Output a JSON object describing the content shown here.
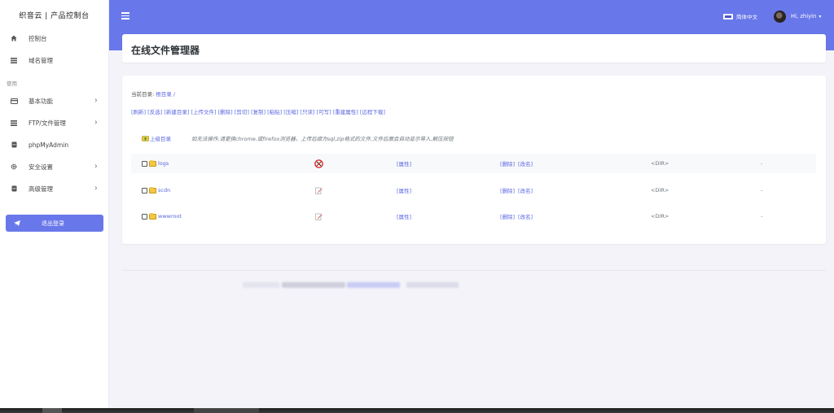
{
  "sidebar": {
    "brand": "织音云 | 产品控制台",
    "section_label": "使用",
    "items": [
      {
        "label": "控制台",
        "icon": "home-icon",
        "has_submenu": false
      },
      {
        "label": "域名管理",
        "icon": "list-icon",
        "has_submenu": false
      },
      {
        "label": "基本功能",
        "icon": "card-icon",
        "has_submenu": true
      },
      {
        "label": "FTP/文件管理",
        "icon": "list-icon",
        "has_submenu": true
      },
      {
        "label": "phpMyAdmin",
        "icon": "database-icon",
        "has_submenu": false
      },
      {
        "label": "安全设置",
        "icon": "gear-icon",
        "has_submenu": true
      },
      {
        "label": "高级管理",
        "icon": "database-icon",
        "has_submenu": true
      }
    ],
    "logout_label": "退出登录"
  },
  "header": {
    "language_label": "简体中文",
    "user_greeting": "Hi, zhiyin",
    "accent_color": "#6877ea"
  },
  "page": {
    "title": "在线文件管理器"
  },
  "filemanager": {
    "current_dir_label": "当前目录:",
    "current_dir_path": "根目录 /",
    "actions": [
      "[刷新]",
      "[反选]",
      "[新建目录]",
      "[上传文件]",
      "[删除]",
      "[剪切]",
      "[复制]",
      "[粘贴]",
      "[压缩]",
      "[只读]",
      "[可写]",
      "[重建属性]",
      "[远程下载]"
    ],
    "up_dir_label": "上级目录",
    "note": "如无法操作,请更换chrome,或firefox浏览器。上传后缀为sql,zip格式的文件,文件后面会自动显示导入,解压按钮",
    "files": [
      {
        "name": "logs",
        "perm_icon": "no-write-icon",
        "prop": "[属性]",
        "delete": "[删除]",
        "rename": "[改名]",
        "type": "<DIR>",
        "size": "-"
      },
      {
        "name": "scdn",
        "perm_icon": "edit-icon",
        "prop": "[属性]",
        "delete": "[删除]",
        "rename": "[改名]",
        "type": "<DIR>",
        "size": "-"
      },
      {
        "name": "wwwroot",
        "perm_icon": "edit-icon",
        "prop": "[属性]",
        "delete": "[删除]",
        "rename": "[改名]",
        "type": "<DIR>",
        "size": "-"
      }
    ]
  }
}
